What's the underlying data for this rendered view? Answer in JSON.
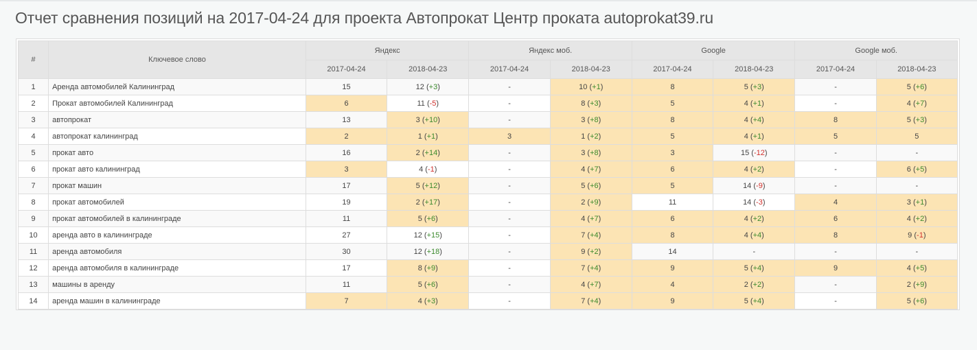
{
  "title": "Отчет сравнения позиций на 2017-04-24 для проекта Автопрокат Центр проката autoprokat39.ru",
  "colors": {
    "highlight": "#fce4b4",
    "positive": "#3c8a2e",
    "negative": "#d0302c",
    "header_bg": "#e6e6e6"
  },
  "table": {
    "col_num": "#",
    "col_keyword": "Ключевое слово",
    "engines": [
      "Яндекс",
      "Яндекс моб.",
      "Google",
      "Google моб."
    ],
    "dates": [
      "2017-04-24",
      "2018-04-23"
    ],
    "rows": [
      {
        "n": "1",
        "kw": "Аренда автомобилей Калининград",
        "c": [
          {
            "v": "15",
            "hl": false
          },
          {
            "v": "12",
            "d": "+3",
            "hl": false
          },
          {
            "v": "-",
            "hl": false
          },
          {
            "v": "10",
            "d": "+1",
            "hl": true
          },
          {
            "v": "8",
            "hl": true
          },
          {
            "v": "5",
            "d": "+3",
            "hl": true
          },
          {
            "v": "-",
            "hl": false
          },
          {
            "v": "5",
            "d": "+6",
            "hl": true
          }
        ]
      },
      {
        "n": "2",
        "kw": "Прокат автомобилей Калининград",
        "c": [
          {
            "v": "6",
            "hl": true
          },
          {
            "v": "11",
            "d": "-5",
            "hl": false
          },
          {
            "v": "-",
            "hl": false
          },
          {
            "v": "8",
            "d": "+3",
            "hl": true
          },
          {
            "v": "5",
            "hl": true
          },
          {
            "v": "4",
            "d": "+1",
            "hl": true
          },
          {
            "v": "-",
            "hl": false
          },
          {
            "v": "4",
            "d": "+7",
            "hl": true
          }
        ]
      },
      {
        "n": "3",
        "kw": "автопрокат",
        "c": [
          {
            "v": "13",
            "hl": false
          },
          {
            "v": "3",
            "d": "+10",
            "hl": true
          },
          {
            "v": "-",
            "hl": false
          },
          {
            "v": "3",
            "d": "+8",
            "hl": true
          },
          {
            "v": "8",
            "hl": true
          },
          {
            "v": "4",
            "d": "+4",
            "hl": true
          },
          {
            "v": "8",
            "hl": true
          },
          {
            "v": "5",
            "d": "+3",
            "hl": true
          }
        ]
      },
      {
        "n": "4",
        "kw": "автопрокат калининград",
        "c": [
          {
            "v": "2",
            "hl": true
          },
          {
            "v": "1",
            "d": "+1",
            "hl": true
          },
          {
            "v": "3",
            "hl": true
          },
          {
            "v": "1",
            "d": "+2",
            "hl": true
          },
          {
            "v": "5",
            "hl": true
          },
          {
            "v": "4",
            "d": "+1",
            "hl": true
          },
          {
            "v": "5",
            "hl": true
          },
          {
            "v": "5",
            "hl": true
          }
        ]
      },
      {
        "n": "5",
        "kw": "прокат авто",
        "c": [
          {
            "v": "16",
            "hl": false
          },
          {
            "v": "2",
            "d": "+14",
            "hl": true
          },
          {
            "v": "-",
            "hl": false
          },
          {
            "v": "3",
            "d": "+8",
            "hl": true
          },
          {
            "v": "3",
            "hl": true
          },
          {
            "v": "15",
            "d": "-12",
            "hl": false
          },
          {
            "v": "-",
            "hl": false
          },
          {
            "v": "-",
            "hl": false
          }
        ]
      },
      {
        "n": "6",
        "kw": "прокат авто калининград",
        "c": [
          {
            "v": "3",
            "hl": true
          },
          {
            "v": "4",
            "d": "-1",
            "hl": false
          },
          {
            "v": "-",
            "hl": false
          },
          {
            "v": "4",
            "d": "+7",
            "hl": true
          },
          {
            "v": "6",
            "hl": true
          },
          {
            "v": "4",
            "d": "+2",
            "hl": true
          },
          {
            "v": "-",
            "hl": false
          },
          {
            "v": "6",
            "d": "+5",
            "hl": true
          }
        ]
      },
      {
        "n": "7",
        "kw": "прокат машин",
        "c": [
          {
            "v": "17",
            "hl": false
          },
          {
            "v": "5",
            "d": "+12",
            "hl": true
          },
          {
            "v": "-",
            "hl": false
          },
          {
            "v": "5",
            "d": "+6",
            "hl": true
          },
          {
            "v": "5",
            "hl": true
          },
          {
            "v": "14",
            "d": "-9",
            "hl": false
          },
          {
            "v": "-",
            "hl": false
          },
          {
            "v": "-",
            "hl": false
          }
        ]
      },
      {
        "n": "8",
        "kw": "прокат автомобилей",
        "c": [
          {
            "v": "19",
            "hl": false
          },
          {
            "v": "2",
            "d": "+17",
            "hl": true
          },
          {
            "v": "-",
            "hl": false
          },
          {
            "v": "2",
            "d": "+9",
            "hl": true
          },
          {
            "v": "11",
            "hl": false
          },
          {
            "v": "14",
            "d": "-3",
            "hl": false
          },
          {
            "v": "4",
            "hl": true
          },
          {
            "v": "3",
            "d": "+1",
            "hl": true
          }
        ]
      },
      {
        "n": "9",
        "kw": "прокат автомобилей в калининграде",
        "c": [
          {
            "v": "11",
            "hl": false
          },
          {
            "v": "5",
            "d": "+6",
            "hl": true
          },
          {
            "v": "-",
            "hl": false
          },
          {
            "v": "4",
            "d": "+7",
            "hl": true
          },
          {
            "v": "6",
            "hl": true
          },
          {
            "v": "4",
            "d": "+2",
            "hl": true
          },
          {
            "v": "6",
            "hl": true
          },
          {
            "v": "4",
            "d": "+2",
            "hl": true
          }
        ]
      },
      {
        "n": "10",
        "kw": "аренда авто в калининграде",
        "c": [
          {
            "v": "27",
            "hl": false
          },
          {
            "v": "12",
            "d": "+15",
            "hl": false
          },
          {
            "v": "-",
            "hl": false
          },
          {
            "v": "7",
            "d": "+4",
            "hl": true
          },
          {
            "v": "8",
            "hl": true
          },
          {
            "v": "4",
            "d": "+4",
            "hl": true
          },
          {
            "v": "8",
            "hl": true
          },
          {
            "v": "9",
            "d": "-1",
            "hl": true
          }
        ]
      },
      {
        "n": "11",
        "kw": "аренда автомобиля",
        "c": [
          {
            "v": "30",
            "hl": false
          },
          {
            "v": "12",
            "d": "+18",
            "hl": false
          },
          {
            "v": "-",
            "hl": false
          },
          {
            "v": "9",
            "d": "+2",
            "hl": true
          },
          {
            "v": "14",
            "hl": false
          },
          {
            "v": "-",
            "hl": false
          },
          {
            "v": "-",
            "hl": false
          },
          {
            "v": "-",
            "hl": false
          }
        ]
      },
      {
        "n": "12",
        "kw": "аренда автомобиля в калининграде",
        "c": [
          {
            "v": "17",
            "hl": false
          },
          {
            "v": "8",
            "d": "+9",
            "hl": true
          },
          {
            "v": "-",
            "hl": false
          },
          {
            "v": "7",
            "d": "+4",
            "hl": true
          },
          {
            "v": "9",
            "hl": true
          },
          {
            "v": "5",
            "d": "+4",
            "hl": true
          },
          {
            "v": "9",
            "hl": true
          },
          {
            "v": "4",
            "d": "+5",
            "hl": true
          }
        ]
      },
      {
        "n": "13",
        "kw": "машины в аренду",
        "c": [
          {
            "v": "11",
            "hl": false
          },
          {
            "v": "5",
            "d": "+6",
            "hl": true
          },
          {
            "v": "-",
            "hl": false
          },
          {
            "v": "4",
            "d": "+7",
            "hl": true
          },
          {
            "v": "4",
            "hl": true
          },
          {
            "v": "2",
            "d": "+2",
            "hl": true
          },
          {
            "v": "-",
            "hl": false
          },
          {
            "v": "2",
            "d": "+9",
            "hl": true
          }
        ]
      },
      {
        "n": "14",
        "kw": "аренда машин в калининграде",
        "c": [
          {
            "v": "7",
            "hl": true
          },
          {
            "v": "4",
            "d": "+3",
            "hl": true
          },
          {
            "v": "-",
            "hl": false
          },
          {
            "v": "7",
            "d": "+4",
            "hl": true
          },
          {
            "v": "9",
            "hl": true
          },
          {
            "v": "5",
            "d": "+4",
            "hl": true
          },
          {
            "v": "-",
            "hl": false
          },
          {
            "v": "5",
            "d": "+6",
            "hl": true
          }
        ]
      }
    ]
  }
}
